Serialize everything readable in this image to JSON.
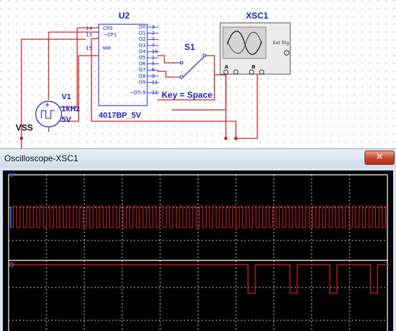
{
  "schematic": {
    "counter_ref": "U2",
    "counter_part": "4017BP_5V",
    "counter_pins_left": [
      {
        "num": "14",
        "name": "CP0"
      },
      {
        "num": "13",
        "name": "~CP1"
      },
      {
        "num": "15",
        "name": "MR"
      }
    ],
    "counter_pins_right": [
      {
        "num": "3",
        "name": "O0"
      },
      {
        "num": "2",
        "name": "O1"
      },
      {
        "num": "4",
        "name": "O2"
      },
      {
        "num": "7",
        "name": "O3"
      },
      {
        "num": "10",
        "name": "O4"
      },
      {
        "num": "1",
        "name": "O5"
      },
      {
        "num": "5",
        "name": "O6"
      },
      {
        "num": "6",
        "name": "O7"
      },
      {
        "num": "9",
        "name": "O8"
      },
      {
        "num": "11",
        "name": "O9"
      },
      {
        "num": "12",
        "name": "~O5-9"
      }
    ],
    "switch_ref": "S1",
    "switch_key": "Key = Space",
    "source_ref": "V1",
    "source_freq": "1kHz",
    "source_volt": "5V",
    "ground_label": "VSS",
    "scope_ref": "XSC1",
    "scope_ext_trig": "Ext Trig",
    "scope_channel_a": "A",
    "scope_channel_b": "B",
    "wire_color": "#d42020",
    "label_color": "#1c1cc8"
  },
  "window": {
    "title": "Oscilloscope-XSC1",
    "close_glyph": "✕"
  },
  "scope_display": {
    "background": "#000000",
    "trace_a_color": "#e02020",
    "trace_b_color": "#e02020",
    "grid_color": "#ffffff",
    "trace_b_pulse_starts": [
      0.632,
      0.743,
      0.848,
      0.955
    ]
  }
}
